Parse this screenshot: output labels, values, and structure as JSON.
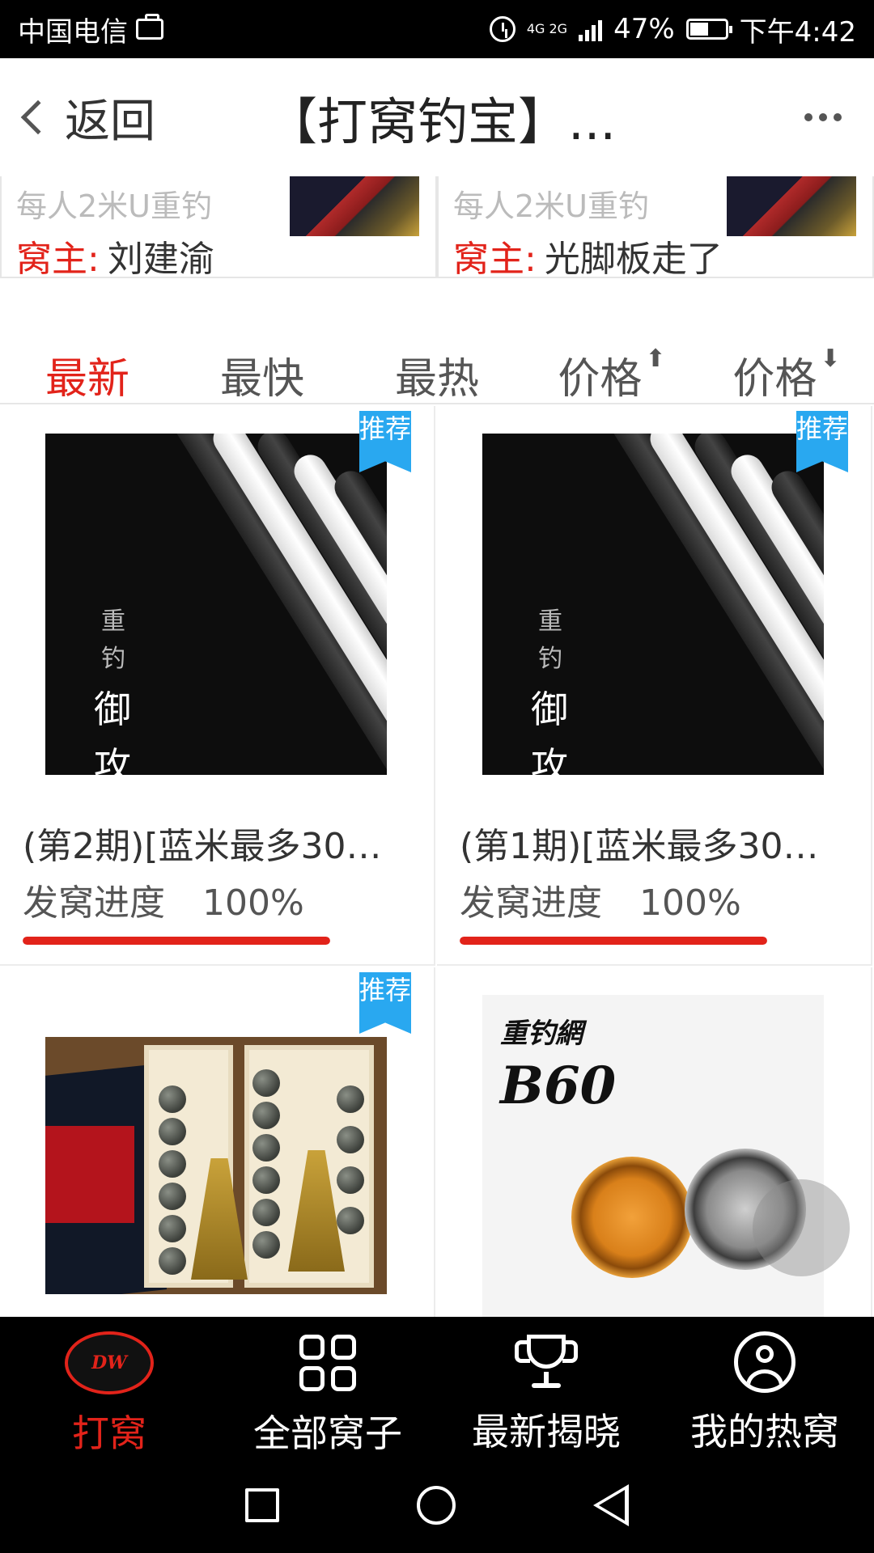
{
  "status_bar": {
    "carrier": "中国电信",
    "network": "4G 2G",
    "battery": "47%",
    "time": "下午4:42"
  },
  "header": {
    "back_label": "返回",
    "title": "【打窝钓宝】...",
    "more_icon": "more-icon"
  },
  "top_cards": [
    {
      "faded_text": "每人2米U重钓",
      "owner_label": "窝主:",
      "owner_name": "刘建渝"
    },
    {
      "faded_text": "每人2米U重钓",
      "owner_label": "窝主:",
      "owner_name": "光脚板走了"
    }
  ],
  "sort_tabs": [
    {
      "label": "最新",
      "active": true
    },
    {
      "label": "最快",
      "active": false
    },
    {
      "label": "最热",
      "active": false
    },
    {
      "label": "价格",
      "arrow": "⬆",
      "active": false
    },
    {
      "label": "价格",
      "arrow": "⬇",
      "active": false
    }
  ],
  "products": [
    {
      "badge": "推荐",
      "image_texts": [
        "重",
        "钓",
        "·",
        "御",
        "攻"
      ],
      "name": "(第2期)[蓝米最多30…",
      "progress_label": "发窝进度",
      "progress_text": "100%",
      "progress": 1.0
    },
    {
      "badge": "推荐",
      "image_texts": [
        "重",
        "钓",
        "·",
        "御",
        "攻"
      ],
      "name": "(第1期)[蓝米最多30…",
      "progress_label": "发窝进度",
      "progress_text": "100%",
      "progress": 1.0
    },
    {
      "badge": "推荐"
    },
    {
      "image_texts": [
        "重钓網",
        "B60"
      ]
    }
  ],
  "bottom_nav": [
    {
      "label": "打窝",
      "icon": "logo-icon",
      "active": true,
      "logo_text": "DW"
    },
    {
      "label": "全部窝子",
      "icon": "grid-icon",
      "active": false
    },
    {
      "label": "最新揭晓",
      "icon": "trophy-icon",
      "active": false
    },
    {
      "label": "我的热窝",
      "icon": "user-icon",
      "active": false
    }
  ],
  "colors": {
    "accent_red": "#e2231a",
    "badge_blue": "#29a8f0",
    "nav_bg": "#000000"
  }
}
